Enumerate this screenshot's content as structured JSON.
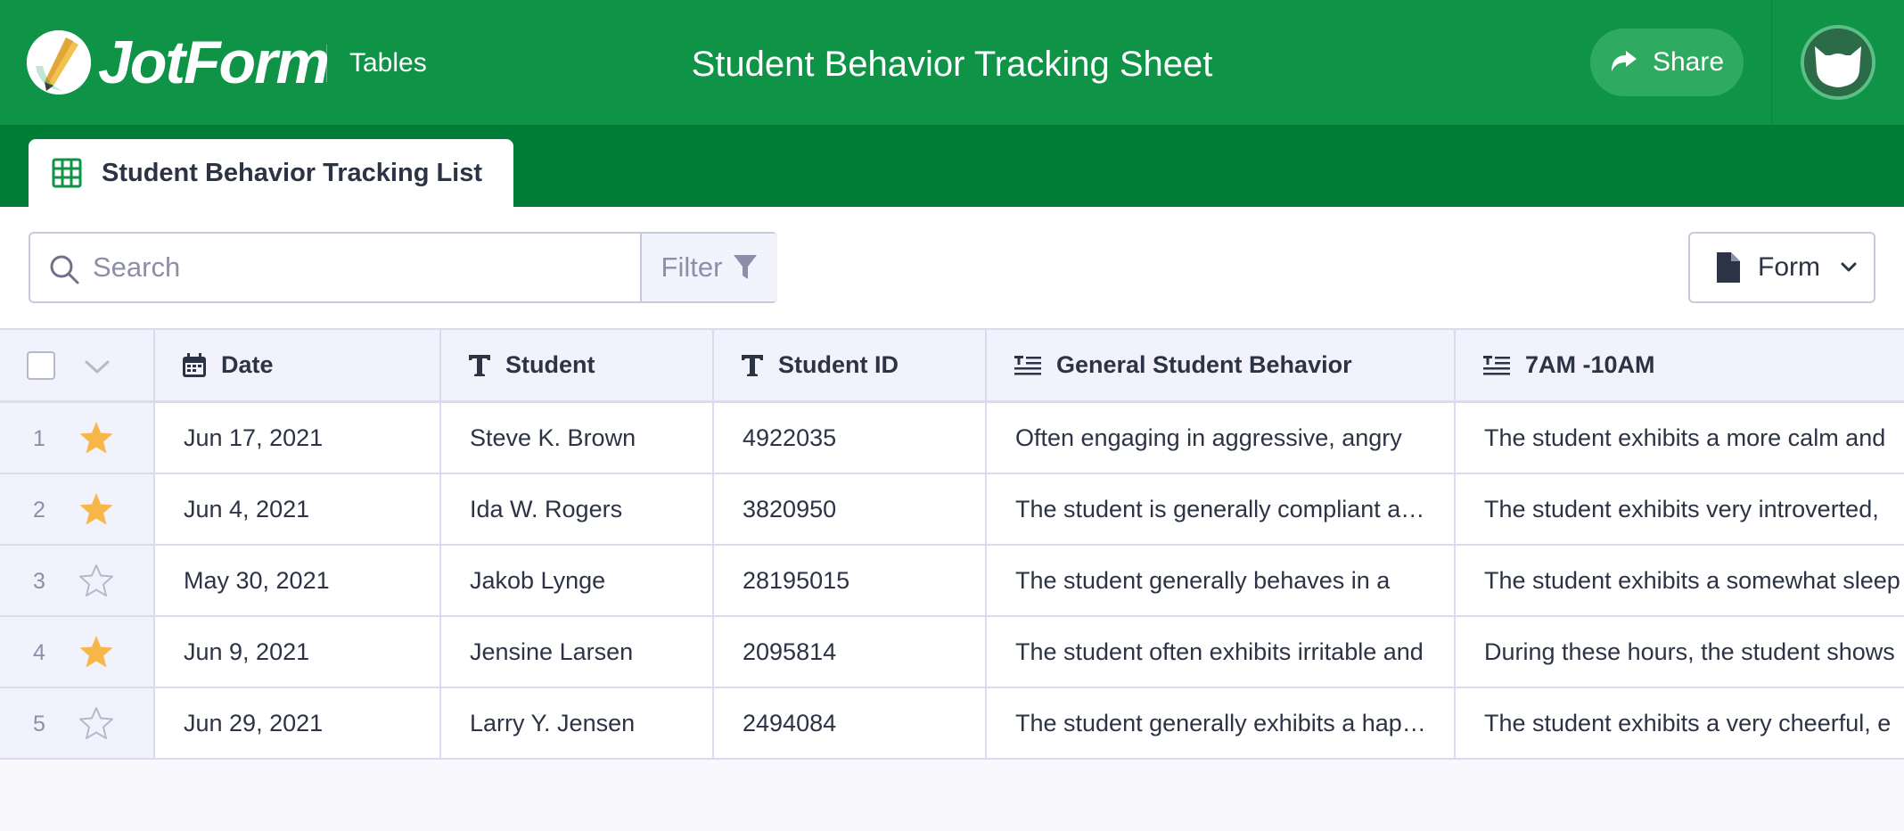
{
  "app": {
    "logo_text": "JotForm",
    "section": "Tables",
    "title": "Student Behavior Tracking Sheet",
    "share_label": "Share"
  },
  "tabs": [
    {
      "label": "Student Behavior Tracking List",
      "icon": "table-grid-icon",
      "active": true
    }
  ],
  "toolbar": {
    "search_placeholder": "Search",
    "filter_label": "Filter",
    "form_label": "Form"
  },
  "table": {
    "columns": [
      {
        "label": "Date",
        "icon": "calendar-icon"
      },
      {
        "label": "Student",
        "icon": "text-type-icon"
      },
      {
        "label": "Student ID",
        "icon": "text-type-icon"
      },
      {
        "label": "General Student Behavior",
        "icon": "long-text-icon"
      },
      {
        "label": "7AM -10AM",
        "icon": "long-text-icon"
      }
    ],
    "rows": [
      {
        "num": "1",
        "starred": true,
        "date": "Jun 17, 2021",
        "student": "Steve K. Brown",
        "student_id": "4922035",
        "general": "Often engaging in aggressive, angry",
        "am": "The student exhibits a more calm and"
      },
      {
        "num": "2",
        "starred": true,
        "date": "Jun 4, 2021",
        "student": "Ida W. Rogers",
        "student_id": "3820950",
        "general": "The student is generally compliant and",
        "am": "The student exhibits very introverted,"
      },
      {
        "num": "3",
        "starred": false,
        "date": "May 30, 2021",
        "student": "Jakob Lynge",
        "student_id": "28195015",
        "general": "The student generally behaves in a",
        "am": "The student exhibits a somewhat sleep"
      },
      {
        "num": "4",
        "starred": true,
        "date": "Jun 9, 2021",
        "student": "Jensine Larsen",
        "student_id": "2095814",
        "general": "The student often exhibits irritable and",
        "am": "During these hours, the student shows"
      },
      {
        "num": "5",
        "starred": false,
        "date": "Jun 29, 2021",
        "student": "Larry Y. Jensen",
        "student_id": "2494084",
        "general": "The student generally exhibits a happy",
        "am": "The student exhibits a very cheerful, e"
      }
    ]
  },
  "colors": {
    "header_green": "#0f9447",
    "tabbar_green": "#007d37",
    "share_button": "#2faa61",
    "star_filled": "#f6b648",
    "star_empty": "#b6b8cc",
    "grid_border": "#dadbef"
  }
}
